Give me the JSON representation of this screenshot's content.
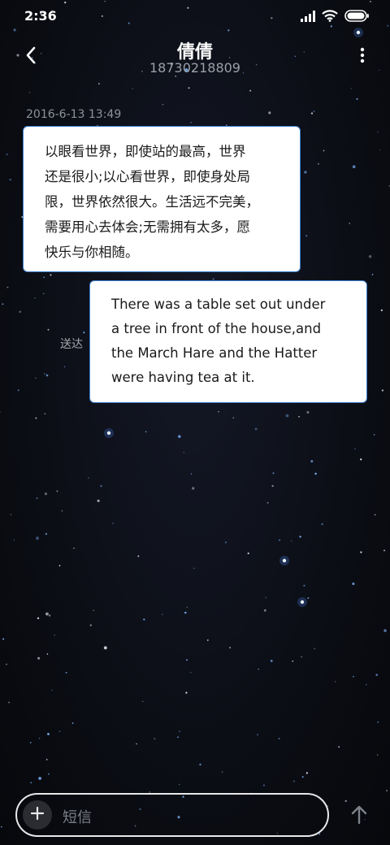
{
  "status_bar": {
    "time": "2:36",
    "icons": [
      "signal-icon",
      "wifi-icon",
      "battery-icon"
    ]
  },
  "header": {
    "contact_name": "倩倩",
    "contact_number": "18730218809",
    "back_icon": "chevron-left-icon",
    "more_icon": "more-vertical-icon"
  },
  "conversation": {
    "timestamp": "2016-6-13 13:49",
    "messages": [
      {
        "direction": "incoming",
        "lines": [
          "以眼看世界，即使站的最高，世界",
          "还是很小;以心看世界，即使身处局",
          "限，世界依然很大。生活远不完美，",
          "需要用心去体会;无需拥有太多，愿",
          "快乐与你相随。"
        ]
      },
      {
        "direction": "outgoing",
        "lines": [
          "There was a table set out under",
          "a tree in front of the house,and",
          "the March Hare and the Hatter",
          "were having tea at it."
        ],
        "status": "送达"
      }
    ]
  },
  "composer": {
    "placeholder": "短信",
    "add_icon": "plus-icon",
    "send_icon": "arrow-up-icon"
  },
  "colors": {
    "bubble_border": "#3b7fd1",
    "background": "#0b0d14"
  }
}
